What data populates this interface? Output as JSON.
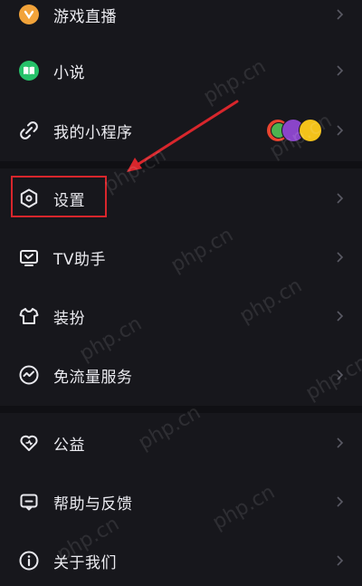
{
  "menu": {
    "items": [
      {
        "label": "游戏直播",
        "icon": "game-live-icon"
      },
      {
        "label": "小说",
        "icon": "book-icon"
      },
      {
        "label": "我的小程序",
        "icon": "mini-program-link-icon"
      },
      {
        "label": "设置",
        "icon": "settings-hexagon-icon"
      },
      {
        "label": "TV助手",
        "icon": "tv-icon"
      },
      {
        "label": "装扮",
        "icon": "shirt-icon"
      },
      {
        "label": "免流量服务",
        "icon": "data-free-icon"
      },
      {
        "label": "公益",
        "icon": "heart-icon"
      },
      {
        "label": "帮助与反馈",
        "icon": "help-message-icon"
      },
      {
        "label": "关于我们",
        "icon": "info-icon"
      }
    ]
  },
  "watermark": "php.cn",
  "colors": {
    "background": "#17171c",
    "text": "#ececf1",
    "chevron": "#5a5a64",
    "annotation": "#d8262c",
    "game_icon": "#f2a33a",
    "novel_icon": "#27c26a"
  }
}
